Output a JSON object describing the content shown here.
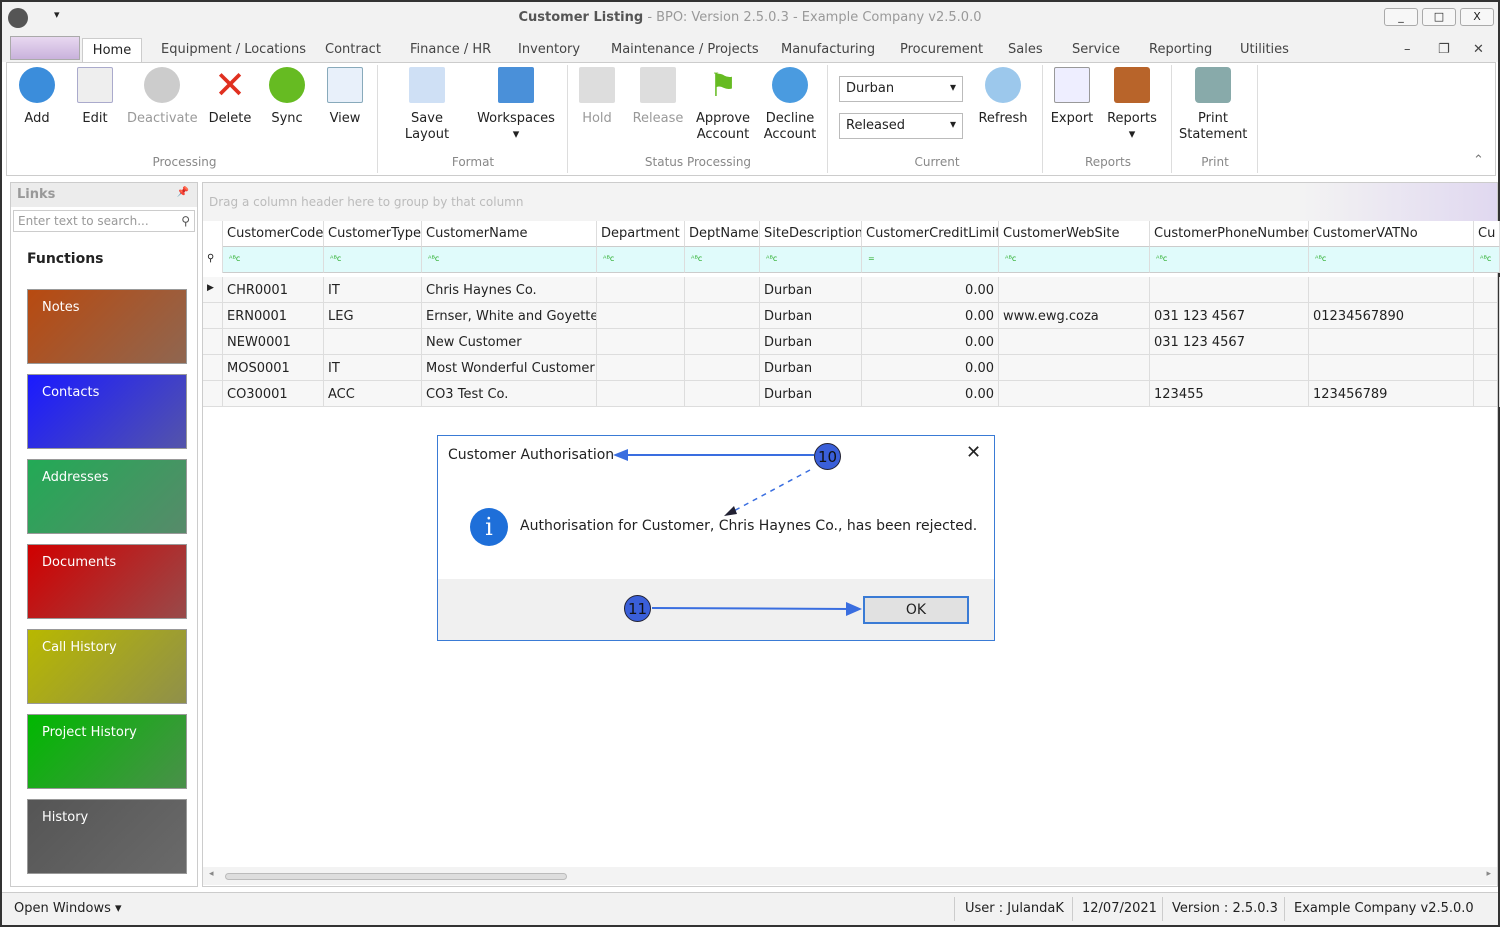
{
  "window": {
    "title_main": "Customer Listing",
    "title_rest": " - BPO: Version 2.5.0.3 - Example Company v2.5.0.0",
    "min": "_",
    "max": "□",
    "close": "X"
  },
  "tabs": [
    "Home",
    "Equipment / Locations",
    "Contract",
    "Finance / HR",
    "Inventory",
    "Maintenance / Projects",
    "Manufacturing",
    "Procurement",
    "Sales",
    "Service",
    "Reporting",
    "Utilities"
  ],
  "ribbon": {
    "processing": {
      "add": "Add",
      "edit": "Edit",
      "deactivate": "Deactivate",
      "delete": "Delete",
      "sync": "Sync",
      "view": "View",
      "group": "Processing"
    },
    "format": {
      "save_layout": "Save Layout",
      "workspaces": "Workspaces",
      "group": "Format"
    },
    "status": {
      "hold": "Hold",
      "release": "Release",
      "approve": "Approve Account",
      "decline": "Decline Account",
      "group": "Status Processing"
    },
    "current": {
      "site": "Durban",
      "status": "Released",
      "refresh": "Refresh",
      "group": "Current"
    },
    "reports": {
      "export": "Export",
      "reports": "Reports",
      "group": "Reports"
    },
    "print": {
      "statement": "Print Statement",
      "group": "Print"
    }
  },
  "links": {
    "title": "Links",
    "search_placeholder": "Enter text to search...",
    "functions": "Functions",
    "tiles": [
      {
        "label": "Notes",
        "color": "#b84a10"
      },
      {
        "label": "Contacts",
        "color": "#1a1aff"
      },
      {
        "label": "Addresses",
        "color": "#22aa55"
      },
      {
        "label": "Documents",
        "color": "#d00000"
      },
      {
        "label": "Call History",
        "color": "#b8b800"
      },
      {
        "label": "Project History",
        "color": "#00b800"
      },
      {
        "label": "History",
        "color": "#555555"
      }
    ]
  },
  "grid": {
    "group_hint": "Drag a column header here to group by that column",
    "columns": [
      "CustomerCode",
      "CustomerType",
      "CustomerName",
      "Department",
      "DeptName",
      "SiteDescription",
      "CustomerCreditLimit",
      "CustomerWebSite",
      "CustomerPhoneNumber",
      "CustomerVATNo",
      "Cu"
    ],
    "rows": [
      [
        "CHR0001",
        "IT",
        "Chris Haynes Co.",
        "",
        "",
        "Durban",
        "0.00",
        "",
        "",
        "",
        ""
      ],
      [
        "ERN0001",
        "LEG",
        "Ernser, White and Goyette",
        "",
        "",
        "Durban",
        "0.00",
        "www.ewg.coza",
        "031 123 4567",
        "01234567890",
        ""
      ],
      [
        "NEW0001",
        "",
        "New Customer",
        "",
        "",
        "Durban",
        "0.00",
        "",
        "031 123 4567",
        "",
        ""
      ],
      [
        "MOS0001",
        "IT",
        "Most Wonderful Customer",
        "",
        "",
        "Durban",
        "0.00",
        "",
        "",
        "",
        ""
      ],
      [
        "CO30001",
        "ACC",
        "CO3 Test Co.",
        "",
        "",
        "Durban",
        "0.00",
        "",
        "123455",
        "123456789",
        ""
      ]
    ]
  },
  "dialog": {
    "title": "Customer Authorisation",
    "message": "Authorisation for Customer, Chris Haynes Co., has been rejected.",
    "ok": "OK",
    "badge_a": "10",
    "badge_b": "11"
  },
  "status": {
    "open_windows": "Open Windows ▾",
    "user": "User : JulandaK",
    "date": "12/07/2021",
    "version": "Version : 2.5.0.3",
    "company": "Example Company v2.5.0.0"
  }
}
